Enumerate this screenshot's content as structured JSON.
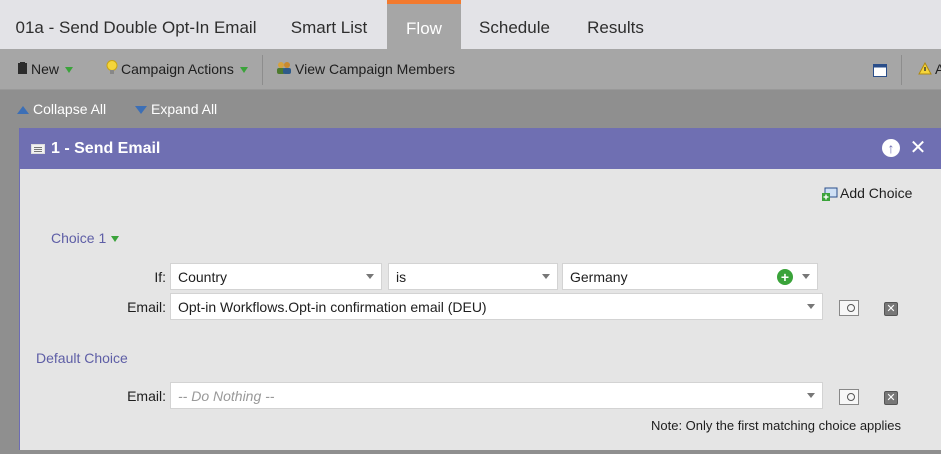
{
  "tabs": {
    "campaign": "01a - Send Double Opt-In Email",
    "smart_list": "Smart List",
    "flow": "Flow",
    "schedule": "Schedule",
    "results": "Results"
  },
  "toolbar": {
    "new_label": "New",
    "campaign_actions_label": "Campaign Actions",
    "view_members_label": "View Campaign Members",
    "truncated_label": "A"
  },
  "expand": {
    "collapse_label": "Collapse All",
    "expand_label": "Expand All"
  },
  "step": {
    "title": "1 - Send Email",
    "add_choice_label": "Add Choice",
    "choice1": {
      "title": "Choice 1",
      "if_label": "If:",
      "field": "Country",
      "operator": "is",
      "value": "Germany",
      "email_label": "Email:",
      "email": "Opt-in Workflows.Opt-in confirmation email (DEU)"
    },
    "default_choice": {
      "title": "Default Choice",
      "email_label": "Email:",
      "email_placeholder": "-- Do Nothing --"
    },
    "note": "Note: Only the first matching choice applies"
  },
  "colors": {
    "accent_orange": "#f37a2e",
    "header_purple": "#6f6fb2",
    "section_purple": "#5e5ea6",
    "add_green": "#3aa33a"
  }
}
